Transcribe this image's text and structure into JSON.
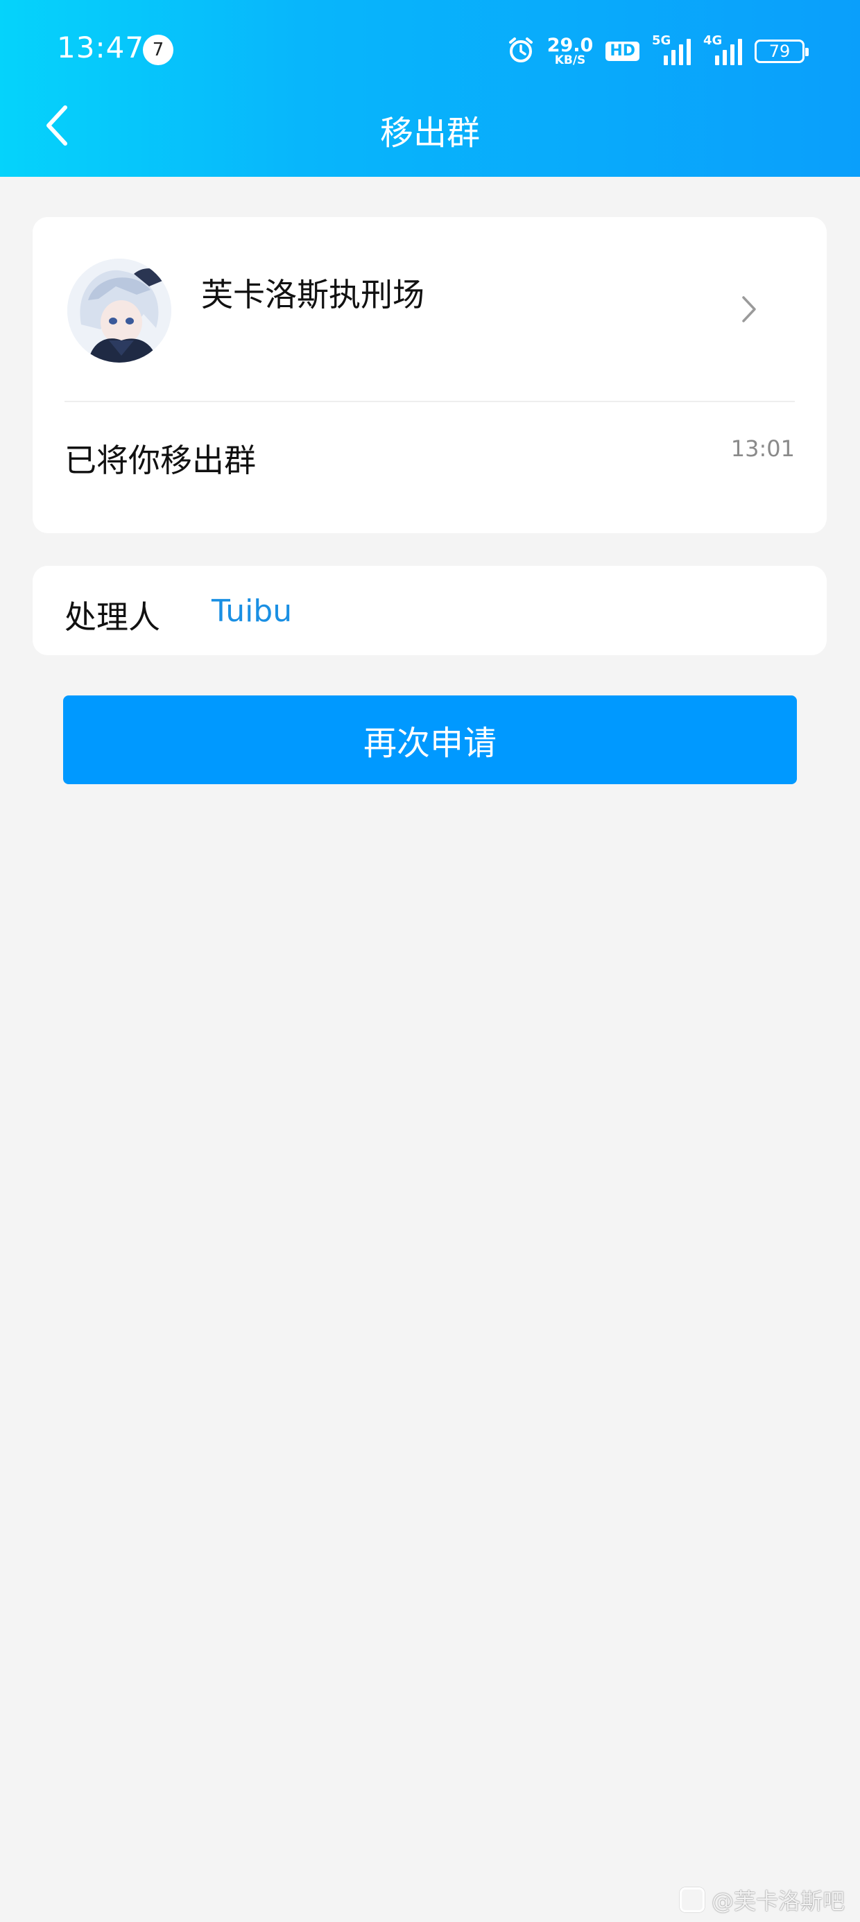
{
  "status_bar": {
    "time": "13:47",
    "notification_count": "7",
    "speed_value": "29.0",
    "speed_unit": "KB/S",
    "hd_label": "HD",
    "network_5g": "5G",
    "network_4g": "4G",
    "battery": "79"
  },
  "header": {
    "title": "移出群"
  },
  "group": {
    "name": "芙卡洛斯执刑场",
    "notice": "已将你移出群",
    "time": "13:01"
  },
  "handler": {
    "label": "处理人",
    "name": "Tuibu"
  },
  "actions": {
    "reapply_label": "再次申请"
  },
  "watermark": {
    "text": "@芙卡洛斯吧"
  },
  "colors": {
    "header_start": "#05d3fb",
    "header_end": "#0a9ffb",
    "button": "#0099ff",
    "link": "#1a8fe3",
    "background": "#f4f4f4"
  }
}
